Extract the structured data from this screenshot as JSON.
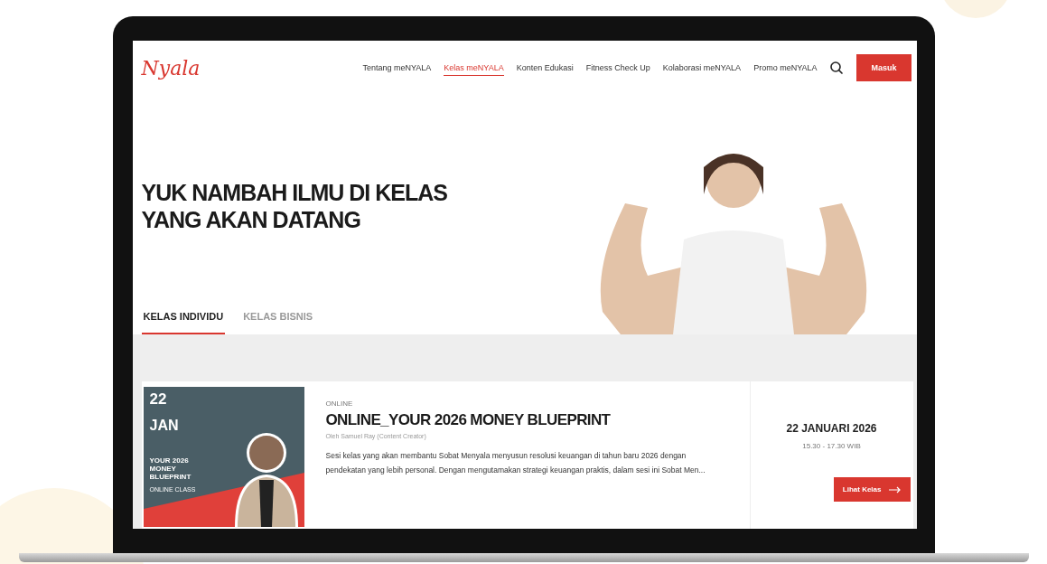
{
  "nav": {
    "logo": "Nyala",
    "items": [
      {
        "label": "Tentang meNYALA",
        "selected": false
      },
      {
        "label": "Kelas meNYALA",
        "selected": true
      },
      {
        "label": "Konten Edukasi",
        "selected": false
      },
      {
        "label": "Fitness Check Up",
        "selected": false
      },
      {
        "label": "Kolaborasi meNYALA",
        "selected": false
      },
      {
        "label": "Promo meNYALA",
        "selected": false
      }
    ],
    "login_button": "Masuk"
  },
  "hero": {
    "title": "YUK NAMBAH ILMU DI KELAS YANG AKAN DATANG"
  },
  "tabs": [
    {
      "label": "KELAS INDIVIDU",
      "selected": true
    },
    {
      "label": "KELAS BISNIS",
      "selected": false
    }
  ],
  "class_card": {
    "thumbnail": {
      "day": "22",
      "month": "JAN",
      "title": "YOUR 2026 MONEY BLUEPRINT",
      "tag": "ONLINE CLASS"
    },
    "category": "ONLINE",
    "title": "ONLINE_YOUR 2026 MONEY BLUEPRINT",
    "speaker": "Oleh Samuel Ray (Content Creator)",
    "description": "Sesi kelas yang akan membantu Sobat Menyala menyusun resolusi keuangan di tahun baru 2026 dengan pendekatan yang lebih personal. Dengan mengutamakan strategi keuangan praktis, dalam sesi ini Sobat Men...",
    "date": "22 JANUARI 2026",
    "time": "15.30 - 17.30 WIB",
    "button": "Lihat Kelas"
  }
}
